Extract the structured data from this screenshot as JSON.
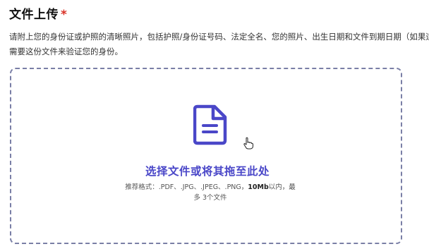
{
  "upload_section": {
    "title": "文件上传",
    "required_mark": "*",
    "description_line1": "请附上您的身份证或护照的清晰照片，包括护照/身份证号码、法定全名、您的照片、出生日期和文件到期日期（如果适用",
    "description_line2": "需要这份文件来验证您的身份。"
  },
  "drop_zone": {
    "icon": "document-icon",
    "title": "选择文件或将其拖至此处",
    "hint_prefix": "推荐格式：.PDF、.JPG、.JPEG、.PNG，",
    "hint_size": "10Mb",
    "hint_suffix": "以内，最",
    "hint_line2": "多 3个文件",
    "accent_color": "#4a47c8",
    "border_color": "#7a7fa6"
  },
  "cursor": {
    "icon": "hand-pointer-icon"
  }
}
